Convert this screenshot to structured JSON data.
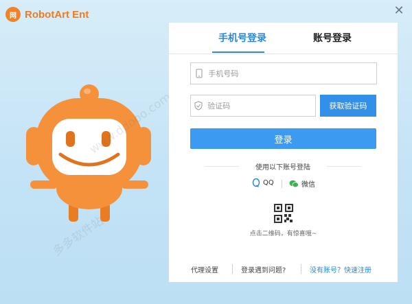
{
  "app": {
    "name": "RobotArt Ent",
    "logo_text": "网"
  },
  "tabs": [
    {
      "label": "手机号登录",
      "active": true
    },
    {
      "label": "账号登录",
      "active": false
    }
  ],
  "form": {
    "phone_placeholder": "手机号码",
    "code_placeholder": "验证码",
    "get_code_label": "获取验证码",
    "login_label": "登录"
  },
  "social": {
    "header": "使用以下账号登陆",
    "qq_label": "QQ",
    "wechat_label": "微信"
  },
  "qr": {
    "hint": "点击二维码，有惊喜哦~"
  },
  "footer": {
    "proxy": "代理设置",
    "problem": "登录遇到问题?",
    "register": "没有账号？快速注册"
  },
  "watermark": {
    "site": "www.ddooo.com",
    "name": "多多软件站"
  },
  "colors": {
    "accent": "#3390e8",
    "brand": "#f07a1c",
    "robot": "#f5913a"
  }
}
